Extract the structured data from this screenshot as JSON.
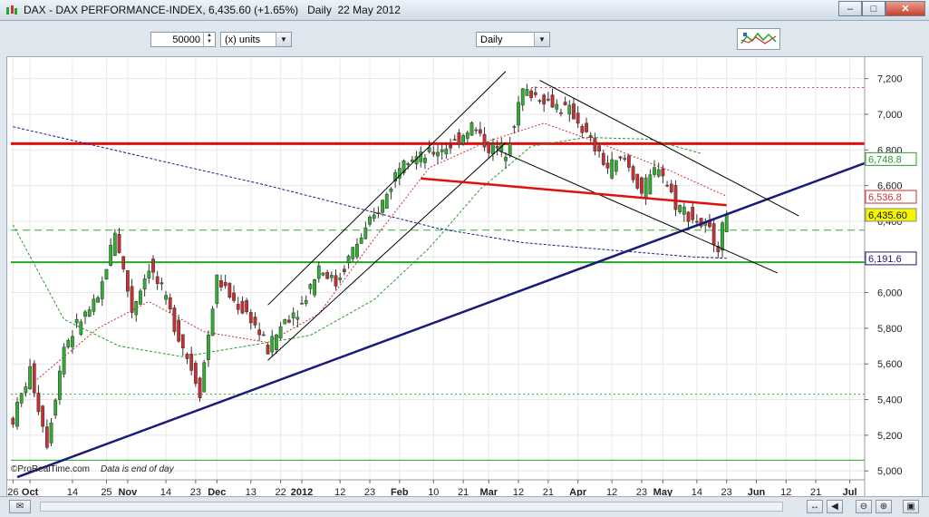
{
  "window": {
    "title": "DAX - DAX PERFORMANCE-INDEX",
    "last": "6,435.60",
    "change": "(+1.65%)",
    "period": "Daily",
    "date": "22 May 2012"
  },
  "toolbar": {
    "quantity": "50000",
    "units": "(x) units",
    "timeframe": "Daily"
  },
  "watermark": {
    "brand": "©ProRealTime.com",
    "note": "Data is end of day"
  },
  "colors": {
    "up": "#2fae2f",
    "down": "#c83030",
    "resistance": "#e01010",
    "support": "#22aa22",
    "trend": "#1a1a7a"
  },
  "chart_data": {
    "type": "candlestick",
    "ylim": [
      4950,
      7310
    ],
    "y_ticks": [
      "5,000",
      "5,200",
      "5,400",
      "5,600",
      "5,800",
      "6,000",
      "6,200",
      "6,400",
      "6,600",
      "6,800",
      "7,000",
      "7,200"
    ],
    "x_ticks": [
      {
        "label": "26",
        "i": 0
      },
      {
        "label": "Oct",
        "i": 4
      },
      {
        "label": "14",
        "i": 14
      },
      {
        "label": "25",
        "i": 22
      },
      {
        "label": "Nov",
        "i": 27
      },
      {
        "label": "14",
        "i": 36
      },
      {
        "label": "23",
        "i": 43
      },
      {
        "label": "Dec",
        "i": 48
      },
      {
        "label": "13",
        "i": 56
      },
      {
        "label": "22",
        "i": 63
      },
      {
        "label": "2012",
        "i": 68
      },
      {
        "label": "12",
        "i": 77
      },
      {
        "label": "23",
        "i": 84
      },
      {
        "label": "Feb",
        "i": 91
      },
      {
        "label": "10",
        "i": 99
      },
      {
        "label": "21",
        "i": 106
      },
      {
        "label": "Mar",
        "i": 112
      },
      {
        "label": "12",
        "i": 119
      },
      {
        "label": "21",
        "i": 126
      },
      {
        "label": "Apr",
        "i": 133
      },
      {
        "label": "12",
        "i": 141
      },
      {
        "label": "23",
        "i": 148
      },
      {
        "label": "May",
        "i": 153
      },
      {
        "label": "14",
        "i": 161
      },
      {
        "label": "23",
        "i": 168
      },
      {
        "label": "Jun",
        "i": 175
      },
      {
        "label": "12",
        "i": 182
      },
      {
        "label": "21",
        "i": 189
      },
      {
        "label": "Jul",
        "i": 197
      }
    ],
    "n_slots": 201,
    "price_labels": [
      {
        "text": "6,748.8",
        "value": 6748.8,
        "color": "#2a9a2a"
      },
      {
        "text": "6,536.8",
        "value": 6536.8,
        "color": "#cc3030"
      },
      {
        "text": "6,435.60",
        "value": 6435.6,
        "color": "#111111",
        "highlight": true
      },
      {
        "text": "6,191.6",
        "value": 6191.6,
        "color": "#1a1a6a"
      }
    ],
    "hlines": [
      {
        "name": "resistance",
        "value": 6835,
        "color": "#e01010",
        "width": 3,
        "dash": ""
      },
      {
        "name": "support",
        "value": 6170,
        "color": "#22aa22",
        "width": 2,
        "dash": ""
      },
      {
        "name": "mid",
        "value": 6350,
        "color": "#33aa33",
        "width": 1,
        "dash": "8,5"
      },
      {
        "name": "upper-dotted",
        "value": 7150,
        "color": "#dd4444",
        "width": 1,
        "dash": "2,3"
      },
      {
        "name": "low-dotted",
        "value": 5430,
        "color": "#33aa33",
        "width": 1,
        "dash": "2,3"
      },
      {
        "name": "bottom",
        "value": 5060,
        "color": "#22aa22",
        "width": 1,
        "dash": ""
      }
    ],
    "trendlines": [
      {
        "name": "long-trend",
        "from": [
          1,
          4965
        ],
        "to": [
          201,
          6730
        ],
        "color": "#1a1a7a",
        "width": 2.5
      },
      {
        "name": "channel-low",
        "from": [
          60,
          5620
        ],
        "to": [
          116,
          6840
        ],
        "color": "#000",
        "width": 1
      },
      {
        "name": "channel-high",
        "from": [
          60,
          5930
        ],
        "to": [
          116,
          7240
        ],
        "color": "#000",
        "width": 1
      },
      {
        "name": "down-upper",
        "from": [
          124,
          7190
        ],
        "to": [
          185,
          6430
        ],
        "color": "#000",
        "width": 1
      },
      {
        "name": "down-lower",
        "from": [
          114,
          6800
        ],
        "to": [
          180,
          6110
        ],
        "color": "#000",
        "width": 1
      },
      {
        "name": "neckline",
        "from": [
          96,
          6640
        ],
        "to": [
          168,
          6490
        ],
        "color": "#e01010",
        "width": 2.5
      }
    ],
    "ma200": [
      [
        0,
        6930
      ],
      [
        20,
        6820
      ],
      [
        40,
        6710
      ],
      [
        60,
        6600
      ],
      [
        80,
        6480
      ],
      [
        100,
        6360
      ],
      [
        120,
        6280
      ],
      [
        140,
        6240
      ],
      [
        160,
        6200
      ],
      [
        168,
        6192
      ]
    ],
    "ma50": [
      [
        0,
        6380
      ],
      [
        12,
        5850
      ],
      [
        25,
        5700
      ],
      [
        40,
        5640
      ],
      [
        55,
        5700
      ],
      [
        70,
        5760
      ],
      [
        85,
        5960
      ],
      [
        98,
        6250
      ],
      [
        110,
        6580
      ],
      [
        122,
        6820
      ],
      [
        135,
        6870
      ],
      [
        150,
        6860
      ],
      [
        162,
        6780
      ]
    ],
    "ma20": [
      [
        5,
        5500
      ],
      [
        20,
        5800
      ],
      [
        32,
        5950
      ],
      [
        45,
        5780
      ],
      [
        60,
        5720
      ],
      [
        72,
        5880
      ],
      [
        85,
        6300
      ],
      [
        98,
        6700
      ],
      [
        112,
        6850
      ],
      [
        125,
        6950
      ],
      [
        140,
        6820
      ],
      [
        155,
        6680
      ],
      [
        168,
        6540
      ]
    ],
    "path": [
      [
        0,
        5290
      ],
      [
        4,
        5560
      ],
      [
        8,
        5160
      ],
      [
        12,
        5700
      ],
      [
        16,
        5850
      ],
      [
        20,
        5950
      ],
      [
        24,
        6350
      ],
      [
        28,
        5900
      ],
      [
        32,
        6150
      ],
      [
        36,
        5950
      ],
      [
        40,
        5700
      ],
      [
        44,
        5450
      ],
      [
        48,
        6080
      ],
      [
        52,
        5950
      ],
      [
        56,
        5860
      ],
      [
        60,
        5680
      ],
      [
        64,
        5850
      ],
      [
        68,
        5930
      ],
      [
        72,
        6150
      ],
      [
        76,
        6050
      ],
      [
        80,
        6240
      ],
      [
        84,
        6380
      ],
      [
        88,
        6550
      ],
      [
        92,
        6780
      ],
      [
        96,
        6750
      ],
      [
        100,
        6800
      ],
      [
        104,
        6840
      ],
      [
        108,
        6940
      ],
      [
        112,
        6810
      ],
      [
        116,
        6800
      ],
      [
        120,
        7130
      ],
      [
        124,
        7100
      ],
      [
        128,
        7050
      ],
      [
        132,
        7000
      ],
      [
        136,
        6840
      ],
      [
        140,
        6700
      ],
      [
        144,
        6750
      ],
      [
        148,
        6560
      ],
      [
        152,
        6720
      ],
      [
        156,
        6500
      ],
      [
        160,
        6420
      ],
      [
        164,
        6340
      ],
      [
        166,
        6270
      ],
      [
        168,
        6435
      ]
    ]
  }
}
